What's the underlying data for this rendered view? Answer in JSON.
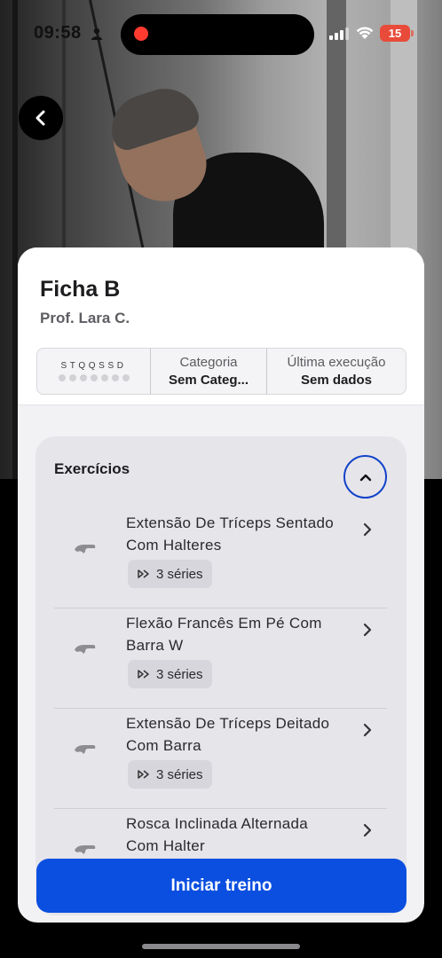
{
  "status_bar": {
    "time": "09:58",
    "battery": "15"
  },
  "workout": {
    "title": "Ficha B",
    "instructor": "Prof. Lara C.",
    "days_letters": "STQQSSD",
    "category_label": "Categoria",
    "category_value": "Sem Categ...",
    "last_exec_label": "Última execução",
    "last_exec_value": "Sem dados"
  },
  "exercises": {
    "header": "Exercícios",
    "items": [
      {
        "name": "Extensão De Tríceps Sentado Com Halteres",
        "sets": "3 séries"
      },
      {
        "name": "Flexão Francês Em Pé Com Barra W",
        "sets": "3 séries"
      },
      {
        "name": "Extensão De Tríceps Deitado Com Barra",
        "sets": "3 séries"
      },
      {
        "name": "Rosca Inclinada Alternada Com Halter",
        "sets": ""
      }
    ]
  },
  "actions": {
    "start_label": "Iniciar treino"
  },
  "colors": {
    "accent": "#0b4fe0",
    "collapse_ring": "#1243c9",
    "battery": "#e84b3a",
    "recording": "#ff3b30"
  },
  "icons": [
    "back-arrow-icon",
    "chevron-up-icon",
    "chevron-right-icon",
    "sets-icon",
    "exercise-thumbnail-icon",
    "person-icon",
    "signal-icon",
    "wifi-icon"
  ]
}
